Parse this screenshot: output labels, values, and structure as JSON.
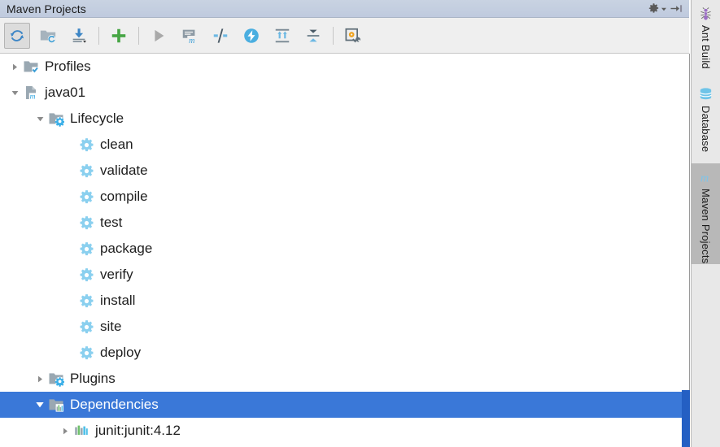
{
  "window": {
    "title": "Maven Projects",
    "titlebar_actions": [
      {
        "name": "settings-gear",
        "icon": "gear-dropdown-icon",
        "label": "Settings"
      },
      {
        "name": "hide-panel",
        "icon": "hide-arrow-icon",
        "label": "Hide"
      }
    ]
  },
  "toolbar": {
    "buttons": [
      {
        "name": "reimport-all-maven-projects",
        "icon": "refresh-icon",
        "label": "Reimport All Maven Projects",
        "state": "pressed",
        "enabled": true
      },
      {
        "name": "generate-sources-and-update-folders",
        "icon": "folder-refresh-icon",
        "label": "Generate Sources and Update Folders For All Projects",
        "state": "normal",
        "enabled": false
      },
      {
        "name": "download-sources-and-documentation",
        "icon": "download-icon",
        "label": "Download Sources and/or Documentation",
        "state": "normal",
        "enabled": true
      },
      {
        "name": "add-maven-project",
        "icon": "plus-icon",
        "label": "Add Maven Projects",
        "state": "normal",
        "enabled": true
      },
      {
        "name": "run-maven-build",
        "icon": "run-icon",
        "label": "Run Maven Build",
        "state": "normal",
        "enabled": false
      },
      {
        "name": "execute-maven-goal",
        "icon": "maven-goal-icon",
        "label": "Execute Maven Goal",
        "state": "normal",
        "enabled": true
      },
      {
        "name": "toggle-skip-tests",
        "icon": "skip-tests-icon",
        "label": "Toggle Skip Tests Mode",
        "state": "normal",
        "enabled": true
      },
      {
        "name": "toggle-offline-mode",
        "icon": "offline-lightning-icon",
        "label": "Toggle Offline Mode",
        "state": "normal",
        "enabled": true
      },
      {
        "name": "expand-all",
        "icon": "expand-all-icon",
        "label": "Expand All",
        "state": "normal",
        "enabled": true
      },
      {
        "name": "collapse-all",
        "icon": "collapse-all-icon",
        "label": "Collapse All",
        "state": "normal",
        "enabled": true
      },
      {
        "name": "maven-settings",
        "icon": "settings-wrench-icon",
        "label": "Maven Settings",
        "state": "normal",
        "enabled": true
      }
    ],
    "separators_after": [
      2,
      3,
      9
    ]
  },
  "tree": {
    "rows": [
      {
        "id": "profiles",
        "label": "Profiles",
        "icon": "folder-check-icon",
        "indent": 0,
        "twisty": "collapsed",
        "selected": false
      },
      {
        "id": "java01",
        "label": "java01",
        "icon": "maven-module-icon",
        "indent": 0,
        "twisty": "expanded",
        "selected": false
      },
      {
        "id": "lifecycle",
        "label": "Lifecycle",
        "icon": "folder-gear-icon",
        "indent": 1,
        "twisty": "expanded",
        "selected": false
      },
      {
        "id": "clean",
        "label": "clean",
        "icon": "gear-icon",
        "indent": 2,
        "twisty": "none",
        "selected": false
      },
      {
        "id": "validate",
        "label": "validate",
        "icon": "gear-icon",
        "indent": 2,
        "twisty": "none",
        "selected": false
      },
      {
        "id": "compile",
        "label": "compile",
        "icon": "gear-icon",
        "indent": 2,
        "twisty": "none",
        "selected": false
      },
      {
        "id": "test",
        "label": "test",
        "icon": "gear-icon",
        "indent": 2,
        "twisty": "none",
        "selected": false
      },
      {
        "id": "package",
        "label": "package",
        "icon": "gear-icon",
        "indent": 2,
        "twisty": "none",
        "selected": false
      },
      {
        "id": "verify",
        "label": "verify",
        "icon": "gear-icon",
        "indent": 2,
        "twisty": "none",
        "selected": false
      },
      {
        "id": "install",
        "label": "install",
        "icon": "gear-icon",
        "indent": 2,
        "twisty": "none",
        "selected": false
      },
      {
        "id": "site",
        "label": "site",
        "icon": "gear-icon",
        "indent": 2,
        "twisty": "none",
        "selected": false
      },
      {
        "id": "deploy",
        "label": "deploy",
        "icon": "gear-icon",
        "indent": 2,
        "twisty": "none",
        "selected": false
      },
      {
        "id": "plugins",
        "label": "Plugins",
        "icon": "folder-gear-icon",
        "indent": 1,
        "twisty": "collapsed",
        "selected": false
      },
      {
        "id": "dependencies",
        "label": "Dependencies",
        "icon": "folder-bars-icon",
        "indent": 1,
        "twisty": "expanded",
        "selected": true
      },
      {
        "id": "junit",
        "label": "junit:junit:4.12",
        "icon": "library-bars-icon",
        "indent": 2,
        "twisty": "collapsed",
        "selected": false
      }
    ]
  },
  "sidebar": {
    "items": [
      {
        "id": "ant-build",
        "label": "Ant Build",
        "icon": "ant-icon",
        "active": false
      },
      {
        "id": "database",
        "label": "Database",
        "icon": "database-icon",
        "active": false
      },
      {
        "id": "maven-projects",
        "label": "Maven Projects",
        "icon": "maven-m-icon",
        "active": true
      }
    ]
  },
  "colors": {
    "titlebar": "#c3cede",
    "toolbar": "#efefef",
    "selection": "#3a78d8",
    "accent_blue": "#5fb4e5",
    "accent_green": "#4aa845",
    "scrollbar": "#245fc3",
    "sidebar": "#e8e8e8",
    "sidebar_active": "#b8b8b8"
  }
}
